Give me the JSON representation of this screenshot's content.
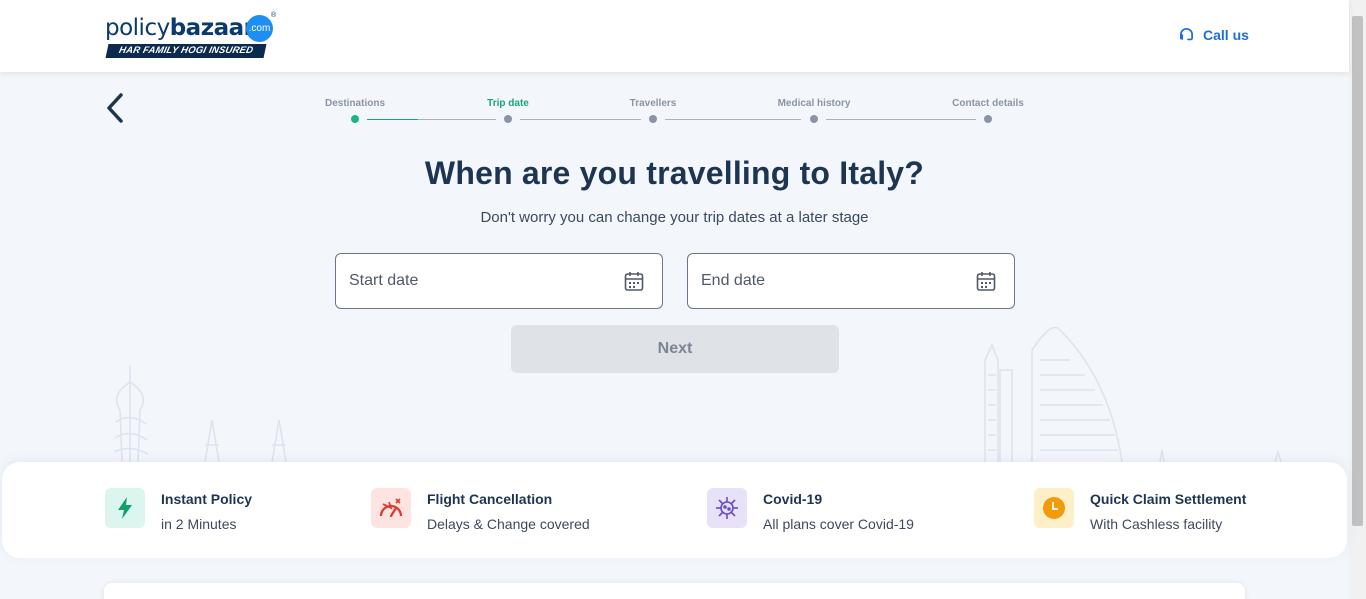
{
  "header": {
    "logo_word_1": "policy",
    "logo_word_2": "bazaar",
    "logo_com": ".com",
    "logo_tm": "®",
    "logo_tagline": "HAR FAMILY HOGI INSURED",
    "call_label": "Call us"
  },
  "stepper": {
    "steps": [
      {
        "label": "Destinations",
        "state": "done"
      },
      {
        "label": "Trip date",
        "state": "active"
      },
      {
        "label": "Travellers",
        "state": "pending"
      },
      {
        "label": "Medical history",
        "state": "pending"
      },
      {
        "label": "Contact details",
        "state": "pending"
      }
    ]
  },
  "main": {
    "title": "When are you travelling to Italy?",
    "subtitle": "Don't worry you can change your trip dates at a later stage",
    "start_date_placeholder": "Start date",
    "end_date_placeholder": "End date",
    "next_label": "Next"
  },
  "features": [
    {
      "title": "Instant Policy",
      "subtitle": "in 2 Minutes",
      "icon": "lightning-icon"
    },
    {
      "title": "Flight Cancellation",
      "subtitle": "Delays & Change covered",
      "icon": "flight-cancel-icon"
    },
    {
      "title": "Covid-19",
      "subtitle": "All plans cover Covid-19",
      "icon": "virus-icon"
    },
    {
      "title": "Quick Claim Settlement",
      "subtitle": "With Cashless facility",
      "icon": "clock-icon"
    }
  ],
  "colors": {
    "brand_navy": "#0a3a6e",
    "accent_green": "#18a57a",
    "link_blue": "#1b6fdc",
    "disabled_button": "#dfe2e7"
  }
}
